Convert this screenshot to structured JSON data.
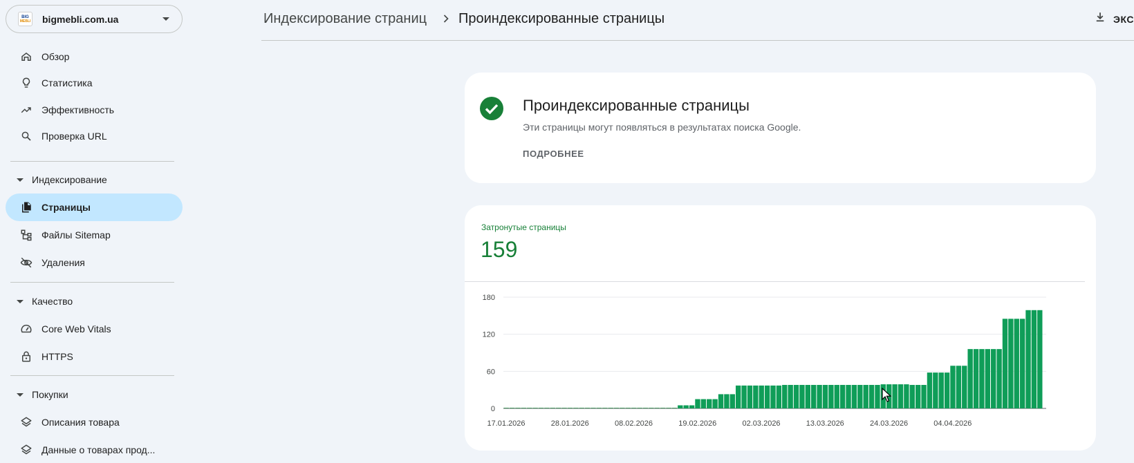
{
  "property": {
    "name": "bigmebli.com.ua",
    "logo_line1": "BIG",
    "logo_line2": "MEBLI"
  },
  "sidebar": {
    "top_items": [
      {
        "label": "Обзор",
        "icon": "home-icon"
      },
      {
        "label": "Статистика",
        "icon": "lightbulb-icon"
      },
      {
        "label": "Эффективность",
        "icon": "trending-up-icon"
      },
      {
        "label": "Проверка URL",
        "icon": "search-icon"
      }
    ],
    "indexing": {
      "title": "Индексирование",
      "items": [
        {
          "label": "Страницы",
          "icon": "pages-icon",
          "active": true
        },
        {
          "label": "Файлы Sitemap",
          "icon": "sitemap-icon"
        },
        {
          "label": "Удаления",
          "icon": "visibility-off-icon"
        }
      ]
    },
    "quality": {
      "title": "Качество",
      "items": [
        {
          "label": "Core Web Vitals",
          "icon": "speed-icon"
        },
        {
          "label": "HTTPS",
          "icon": "lock-icon"
        }
      ]
    },
    "shopping": {
      "title": "Покупки",
      "items": [
        {
          "label": "Описания товара",
          "icon": "layers-icon"
        },
        {
          "label": "Данные о товарах прод...",
          "icon": "layers-icon"
        }
      ]
    }
  },
  "header": {
    "breadcrumb_parent": "Индексирование страниц",
    "breadcrumb_current": "Проиндексированные страницы",
    "export_label": "ЭКС"
  },
  "status": {
    "title": "Проиндексированные страницы",
    "description": "Эти страницы могут появляться в результатах поиска Google.",
    "more_link": "ПОДРОБНЕЕ"
  },
  "metric": {
    "label": "Затронутые страницы",
    "value": "159"
  },
  "colors": {
    "accent_green": "#188038",
    "bar_green": "#0f9d58",
    "active_nav": "#c2e7ff"
  },
  "chart_data": {
    "type": "bar",
    "title": "",
    "xlabel": "",
    "ylabel": "",
    "ylim": [
      0,
      180
    ],
    "yticks": [
      "0",
      "60",
      "120",
      "180"
    ],
    "x_tick_labels": [
      "17.01.2026",
      "28.01.2026",
      "08.02.2026",
      "19.02.2026",
      "02.03.2026",
      "13.03.2026",
      "24.03.2026",
      "04.04.2026"
    ],
    "x_tick_indices": [
      0,
      11,
      22,
      33,
      44,
      55,
      66,
      77
    ],
    "series": [
      {
        "values": [
          0,
          0,
          0,
          0,
          0,
          0,
          0,
          0,
          0,
          0,
          0,
          0,
          0,
          0,
          0,
          0,
          0,
          0,
          0,
          0,
          0,
          0,
          0,
          0,
          0,
          0,
          0,
          0,
          0,
          0,
          5,
          5,
          5,
          15,
          15,
          15,
          15,
          23,
          23,
          23,
          37,
          37,
          37,
          37,
          37,
          37,
          37,
          37,
          38,
          38,
          38,
          38,
          38,
          38,
          38,
          38,
          38,
          38,
          38,
          38,
          38,
          38,
          38,
          38,
          38,
          39,
          39,
          39,
          39,
          39,
          38,
          38,
          38,
          58,
          58,
          58,
          58,
          69,
          69,
          69,
          96,
          96,
          96,
          96,
          96,
          96,
          145,
          145,
          145,
          145,
          159,
          159,
          159
        ]
      }
    ]
  }
}
